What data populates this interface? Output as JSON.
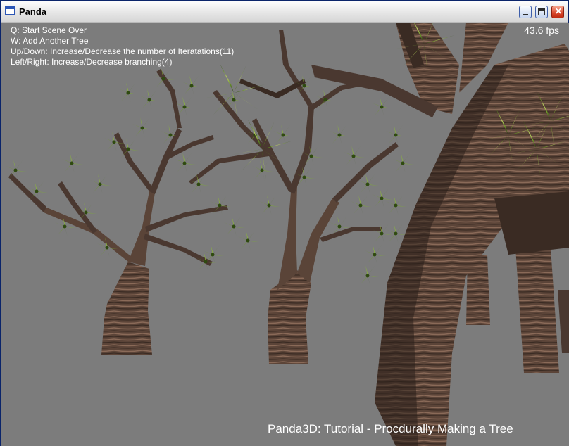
{
  "window": {
    "title": "Panda",
    "icon": "window-icon",
    "buttons": [
      "minimize-icon",
      "maximize-icon",
      "close-icon"
    ],
    "close_symbol": "×"
  },
  "overlay": {
    "help": [
      "Q: Start Scene Over",
      "W: Add Another Tree",
      "Up/Down: Increase/Decrease the number of Iteratations(11)",
      "Left/Right: Increase/Decrease branching(4)"
    ],
    "fps": "43.6 fps",
    "footer_title": "Panda3D: Tutorial - Procdurally Making a Tree"
  },
  "colors": {
    "background": "#7c7c7c",
    "bark": "#5a4438",
    "bark_dark": "#2f221c",
    "leaf": "#6f9a2a",
    "leaf_dark": "#3b5a16",
    "text": "#ffffff"
  }
}
